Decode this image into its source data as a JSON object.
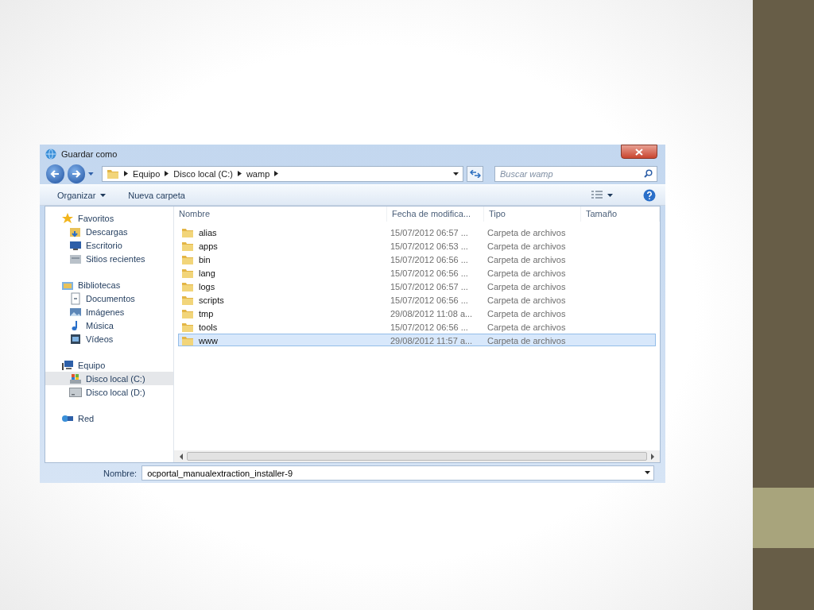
{
  "window": {
    "title": "Guardar como"
  },
  "address_bar": {
    "breadcrumbs": [
      "Equipo",
      "Disco local (C:)",
      "wamp"
    ]
  },
  "search": {
    "placeholder": "Buscar wamp"
  },
  "toolbar": {
    "organize": "Organizar",
    "new_folder": "Nueva carpeta"
  },
  "sidebar": {
    "groups": [
      {
        "label": "Favoritos",
        "kind": "star",
        "selected": false,
        "children": [
          {
            "label": "Descargas",
            "kind": "download",
            "selected": false
          },
          {
            "label": "Escritorio",
            "kind": "desktop",
            "selected": false
          },
          {
            "label": "Sitios recientes",
            "kind": "recent",
            "selected": false
          }
        ]
      },
      {
        "label": "Bibliotecas",
        "kind": "library",
        "selected": false,
        "children": [
          {
            "label": "Documentos",
            "kind": "document",
            "selected": false
          },
          {
            "label": "Imágenes",
            "kind": "pictures",
            "selected": false
          },
          {
            "label": "Música",
            "kind": "music",
            "selected": false
          },
          {
            "label": "Vídeos",
            "kind": "videos",
            "selected": false
          }
        ]
      },
      {
        "label": "Equipo",
        "kind": "computer",
        "selected": false,
        "children": [
          {
            "label": "Disco local (C:)",
            "kind": "system-drive",
            "selected": true
          },
          {
            "label": "Disco local (D:)",
            "kind": "drive",
            "selected": false
          }
        ]
      },
      {
        "label": "Red",
        "kind": "network",
        "selected": false
      }
    ]
  },
  "table": {
    "columns": [
      "Nombre",
      "Fecha de modifica...",
      "Tipo",
      "Tamaño"
    ],
    "rows": [
      {
        "name": "alias",
        "date": "15/07/2012 06:57 ...",
        "type": "Carpeta de archivos",
        "selected": false
      },
      {
        "name": "apps",
        "date": "15/07/2012 06:53 ...",
        "type": "Carpeta de archivos",
        "selected": false
      },
      {
        "name": "bin",
        "date": "15/07/2012 06:56 ...",
        "type": "Carpeta de archivos",
        "selected": false
      },
      {
        "name": "lang",
        "date": "15/07/2012 06:56 ...",
        "type": "Carpeta de archivos",
        "selected": false
      },
      {
        "name": "logs",
        "date": "15/07/2012 06:57 ...",
        "type": "Carpeta de archivos",
        "selected": false
      },
      {
        "name": "scripts",
        "date": "15/07/2012 06:56 ...",
        "type": "Carpeta de archivos",
        "selected": false
      },
      {
        "name": "tmp",
        "date": "29/08/2012 11:08 a...",
        "type": "Carpeta de archivos",
        "selected": false
      },
      {
        "name": "tools",
        "date": "15/07/2012 06:56 ...",
        "type": "Carpeta de archivos",
        "selected": false
      },
      {
        "name": "www",
        "date": "29/08/2012 11:57 a...",
        "type": "Carpeta de archivos",
        "selected": true
      }
    ]
  },
  "filename": {
    "label": "Nombre:",
    "value": "ocportal_manualextraction_installer-9"
  }
}
